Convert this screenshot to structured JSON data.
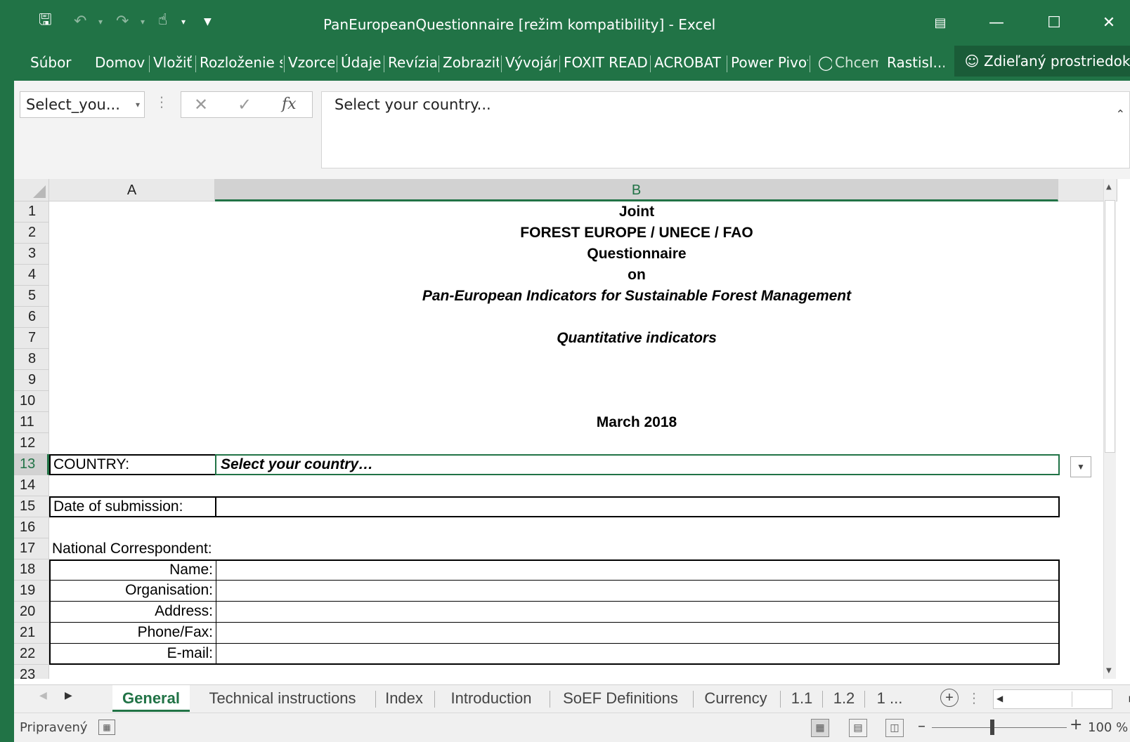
{
  "window": {
    "title": "PanEuropeanQuestionnaire  [režim kompatibility] - Excel"
  },
  "ribbon": {
    "tabs": [
      "Súbor",
      "Domov",
      "Vložiť",
      "Rozloženie s",
      "Vzorce",
      "Údaje",
      "Revízia",
      "Zobraziť",
      "Vývojár",
      "FOXIT READ",
      "ACROBAT",
      "Power Pivot"
    ],
    "tell_me": "Chcem",
    "user": "Rastisl...",
    "share": "Zdieľaný prostriedok"
  },
  "formula_bar": {
    "name_box": "Select_you...",
    "content": "Select your country..."
  },
  "sheet": {
    "columns": [
      "A",
      "B"
    ],
    "rows": [
      "1",
      "2",
      "3",
      "4",
      "5",
      "6",
      "7",
      "8",
      "9",
      "10",
      "11",
      "12",
      "13",
      "14",
      "15",
      "16",
      "17",
      "18",
      "19",
      "20",
      "21",
      "22",
      "23"
    ],
    "header_lines": {
      "r1": "Joint",
      "r2": "FOREST EUROPE / UNECE / FAO",
      "r3": "Questionnaire",
      "r4": "on",
      "r5": "Pan-European Indicators for Sustainable Forest Management",
      "r7": "Quantitative indicators",
      "r11": "March 2018"
    },
    "country_label": "COUNTRY:",
    "country_value": "Select your country…",
    "date_label": "Date of submission:",
    "date_value": "",
    "correspondent_label": "National Correspondent:",
    "correspondent_fields": [
      "Name:",
      "Organisation:",
      "Address:",
      "Phone/Fax:",
      "E-mail:"
    ]
  },
  "sheet_tabs": [
    "General",
    "Technical instructions",
    "Index",
    "Introduction",
    "SoEF Definitions",
    "Currency",
    "1.1",
    "1.2",
    "1 ..."
  ],
  "active_sheet_tab": "General",
  "status": {
    "text": "Pripravený",
    "zoom": "100 %"
  },
  "colors": {
    "excel_green": "#217346",
    "header_gray": "#e9e9e9"
  },
  "icons": {
    "save": "save-icon",
    "undo": "undo-icon",
    "redo": "redo-icon",
    "touch": "touch-mode-icon",
    "customize": "customize-qat-icon",
    "ribbon_display": "ribbon-display-options-icon",
    "minimize": "minimize-icon",
    "maximize": "maximize-icon",
    "close": "close-icon",
    "lightbulb": "lightbulb-icon",
    "person_add": "person-add-icon"
  }
}
